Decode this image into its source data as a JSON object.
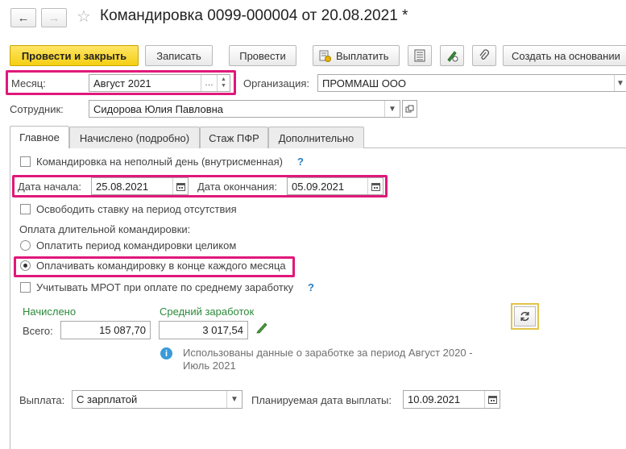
{
  "window": {
    "title": "Командировка 0099-000004 от 20.08.2021 *",
    "back_icon": "←",
    "forward_icon": "→",
    "favorite_icon": "☆"
  },
  "toolbar": {
    "post_close": "Провести и закрыть",
    "save": "Записать",
    "post": "Провести",
    "pay": "Выплатить",
    "create_based": "Создать на основании"
  },
  "header": {
    "month_label": "Месяц:",
    "month_value": "Август 2021",
    "org_label": "Организация:",
    "org_value": "ПРОММАШ ООО",
    "employee_label": "Сотрудник:",
    "employee_value": "Сидорова Юлия Павловна"
  },
  "tabs": [
    {
      "label": "Главное"
    },
    {
      "label": "Начислено (подробно)"
    },
    {
      "label": "Стаж ПФР"
    },
    {
      "label": "Дополнительно"
    }
  ],
  "main": {
    "part_day_label": "Командировка на неполный день (внутрисменная)",
    "part_day_checked": false,
    "help_mark": "?",
    "start_label": "Дата начала:",
    "start_value": "25.08.2021",
    "end_label": "Дата окончания:",
    "end_value": "05.09.2021",
    "free_rate_label": "Освободить ставку на период отсутствия",
    "long_pay_label": "Оплата длительной командировки:",
    "pay_whole_label": "Оплатить период командировки целиком",
    "pay_monthly_label": "Оплачивать командировку в конце каждого месяца",
    "selected_option": "pay_monthly",
    "mrot_label": "Учитывать МРОТ при оплате по среднему заработку",
    "accrued_label": "Начислено",
    "avg_label": "Средний заработок",
    "total_label": "Всего:",
    "total_value": "15 087,70",
    "avg_value": "3 017,54",
    "info_text_1": "Использованы данные о заработке за период Август 2020 -",
    "info_text_2": "Июль 2021",
    "payout_label": "Выплата:",
    "payout_value": "С зарплатой",
    "planned_date_label": "Планируемая дата выплаты:",
    "planned_date_value": "10.09.2021"
  },
  "colors": {
    "highlight": "#e0187a",
    "primary_button": "#f5cf12",
    "green_label": "#2c8a3a",
    "info_icon": "#3a9ad9"
  }
}
